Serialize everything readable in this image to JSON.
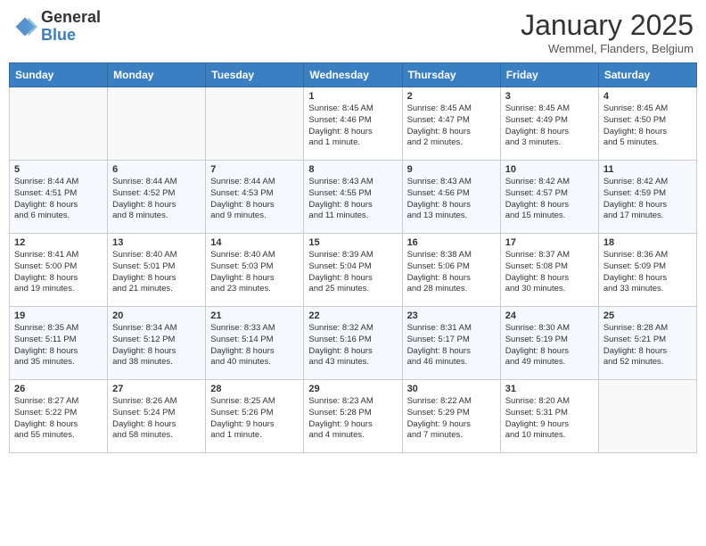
{
  "logo": {
    "general": "General",
    "blue": "Blue"
  },
  "header": {
    "month": "January 2025",
    "location": "Wemmel, Flanders, Belgium"
  },
  "weekdays": [
    "Sunday",
    "Monday",
    "Tuesday",
    "Wednesday",
    "Thursday",
    "Friday",
    "Saturday"
  ],
  "weeks": [
    [
      {
        "day": "",
        "info": ""
      },
      {
        "day": "",
        "info": ""
      },
      {
        "day": "",
        "info": ""
      },
      {
        "day": "1",
        "info": "Sunrise: 8:45 AM\nSunset: 4:46 PM\nDaylight: 8 hours\nand 1 minute."
      },
      {
        "day": "2",
        "info": "Sunrise: 8:45 AM\nSunset: 4:47 PM\nDaylight: 8 hours\nand 2 minutes."
      },
      {
        "day": "3",
        "info": "Sunrise: 8:45 AM\nSunset: 4:49 PM\nDaylight: 8 hours\nand 3 minutes."
      },
      {
        "day": "4",
        "info": "Sunrise: 8:45 AM\nSunset: 4:50 PM\nDaylight: 8 hours\nand 5 minutes."
      }
    ],
    [
      {
        "day": "5",
        "info": "Sunrise: 8:44 AM\nSunset: 4:51 PM\nDaylight: 8 hours\nand 6 minutes."
      },
      {
        "day": "6",
        "info": "Sunrise: 8:44 AM\nSunset: 4:52 PM\nDaylight: 8 hours\nand 8 minutes."
      },
      {
        "day": "7",
        "info": "Sunrise: 8:44 AM\nSunset: 4:53 PM\nDaylight: 8 hours\nand 9 minutes."
      },
      {
        "day": "8",
        "info": "Sunrise: 8:43 AM\nSunset: 4:55 PM\nDaylight: 8 hours\nand 11 minutes."
      },
      {
        "day": "9",
        "info": "Sunrise: 8:43 AM\nSunset: 4:56 PM\nDaylight: 8 hours\nand 13 minutes."
      },
      {
        "day": "10",
        "info": "Sunrise: 8:42 AM\nSunset: 4:57 PM\nDaylight: 8 hours\nand 15 minutes."
      },
      {
        "day": "11",
        "info": "Sunrise: 8:42 AM\nSunset: 4:59 PM\nDaylight: 8 hours\nand 17 minutes."
      }
    ],
    [
      {
        "day": "12",
        "info": "Sunrise: 8:41 AM\nSunset: 5:00 PM\nDaylight: 8 hours\nand 19 minutes."
      },
      {
        "day": "13",
        "info": "Sunrise: 8:40 AM\nSunset: 5:01 PM\nDaylight: 8 hours\nand 21 minutes."
      },
      {
        "day": "14",
        "info": "Sunrise: 8:40 AM\nSunset: 5:03 PM\nDaylight: 8 hours\nand 23 minutes."
      },
      {
        "day": "15",
        "info": "Sunrise: 8:39 AM\nSunset: 5:04 PM\nDaylight: 8 hours\nand 25 minutes."
      },
      {
        "day": "16",
        "info": "Sunrise: 8:38 AM\nSunset: 5:06 PM\nDaylight: 8 hours\nand 28 minutes."
      },
      {
        "day": "17",
        "info": "Sunrise: 8:37 AM\nSunset: 5:08 PM\nDaylight: 8 hours\nand 30 minutes."
      },
      {
        "day": "18",
        "info": "Sunrise: 8:36 AM\nSunset: 5:09 PM\nDaylight: 8 hours\nand 33 minutes."
      }
    ],
    [
      {
        "day": "19",
        "info": "Sunrise: 8:35 AM\nSunset: 5:11 PM\nDaylight: 8 hours\nand 35 minutes."
      },
      {
        "day": "20",
        "info": "Sunrise: 8:34 AM\nSunset: 5:12 PM\nDaylight: 8 hours\nand 38 minutes."
      },
      {
        "day": "21",
        "info": "Sunrise: 8:33 AM\nSunset: 5:14 PM\nDaylight: 8 hours\nand 40 minutes."
      },
      {
        "day": "22",
        "info": "Sunrise: 8:32 AM\nSunset: 5:16 PM\nDaylight: 8 hours\nand 43 minutes."
      },
      {
        "day": "23",
        "info": "Sunrise: 8:31 AM\nSunset: 5:17 PM\nDaylight: 8 hours\nand 46 minutes."
      },
      {
        "day": "24",
        "info": "Sunrise: 8:30 AM\nSunset: 5:19 PM\nDaylight: 8 hours\nand 49 minutes."
      },
      {
        "day": "25",
        "info": "Sunrise: 8:28 AM\nSunset: 5:21 PM\nDaylight: 8 hours\nand 52 minutes."
      }
    ],
    [
      {
        "day": "26",
        "info": "Sunrise: 8:27 AM\nSunset: 5:22 PM\nDaylight: 8 hours\nand 55 minutes."
      },
      {
        "day": "27",
        "info": "Sunrise: 8:26 AM\nSunset: 5:24 PM\nDaylight: 8 hours\nand 58 minutes."
      },
      {
        "day": "28",
        "info": "Sunrise: 8:25 AM\nSunset: 5:26 PM\nDaylight: 9 hours\nand 1 minute."
      },
      {
        "day": "29",
        "info": "Sunrise: 8:23 AM\nSunset: 5:28 PM\nDaylight: 9 hours\nand 4 minutes."
      },
      {
        "day": "30",
        "info": "Sunrise: 8:22 AM\nSunset: 5:29 PM\nDaylight: 9 hours\nand 7 minutes."
      },
      {
        "day": "31",
        "info": "Sunrise: 8:20 AM\nSunset: 5:31 PM\nDaylight: 9 hours\nand 10 minutes."
      },
      {
        "day": "",
        "info": ""
      }
    ]
  ]
}
